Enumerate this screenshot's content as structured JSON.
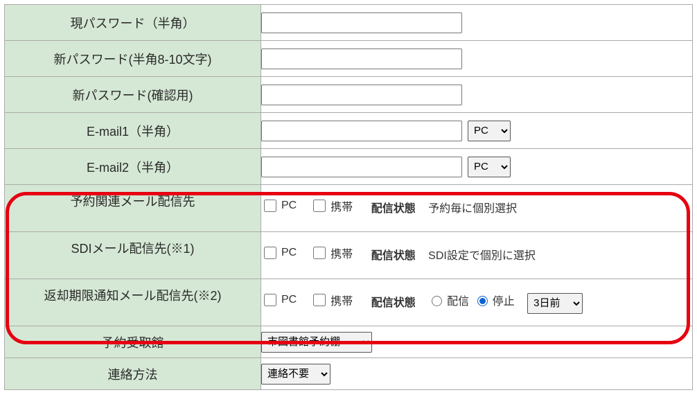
{
  "labels": {
    "current_password": "現パスワード（半角）",
    "new_password": "新パスワード(半角8-10文字)",
    "confirm_password": "新パスワード(確認用)",
    "email1": "E-mail1（半角）",
    "email2": "E-mail2（半角）",
    "reserve_mail_dest": "予約関連メール配信先",
    "sdi_mail_dest": "SDIメール配信先(※1)",
    "return_mail_dest": "返却期限通知メール配信先(※2)",
    "pickup_library": "予約受取館",
    "contact_method": "連絡方法"
  },
  "email_type_options": {
    "pc": "PC"
  },
  "checkbox_labels": {
    "pc": "PC",
    "mobile": "携帯"
  },
  "status_heading": "配信状態",
  "status_text": {
    "reserve": "予約毎に個別選択",
    "sdi": "SDI設定で個別に選択"
  },
  "radio_labels": {
    "send": "配信",
    "stop": "停止"
  },
  "return_days_option": "3日前",
  "pickup_option": "市図書館予約棚",
  "contact_option": "連絡不要"
}
